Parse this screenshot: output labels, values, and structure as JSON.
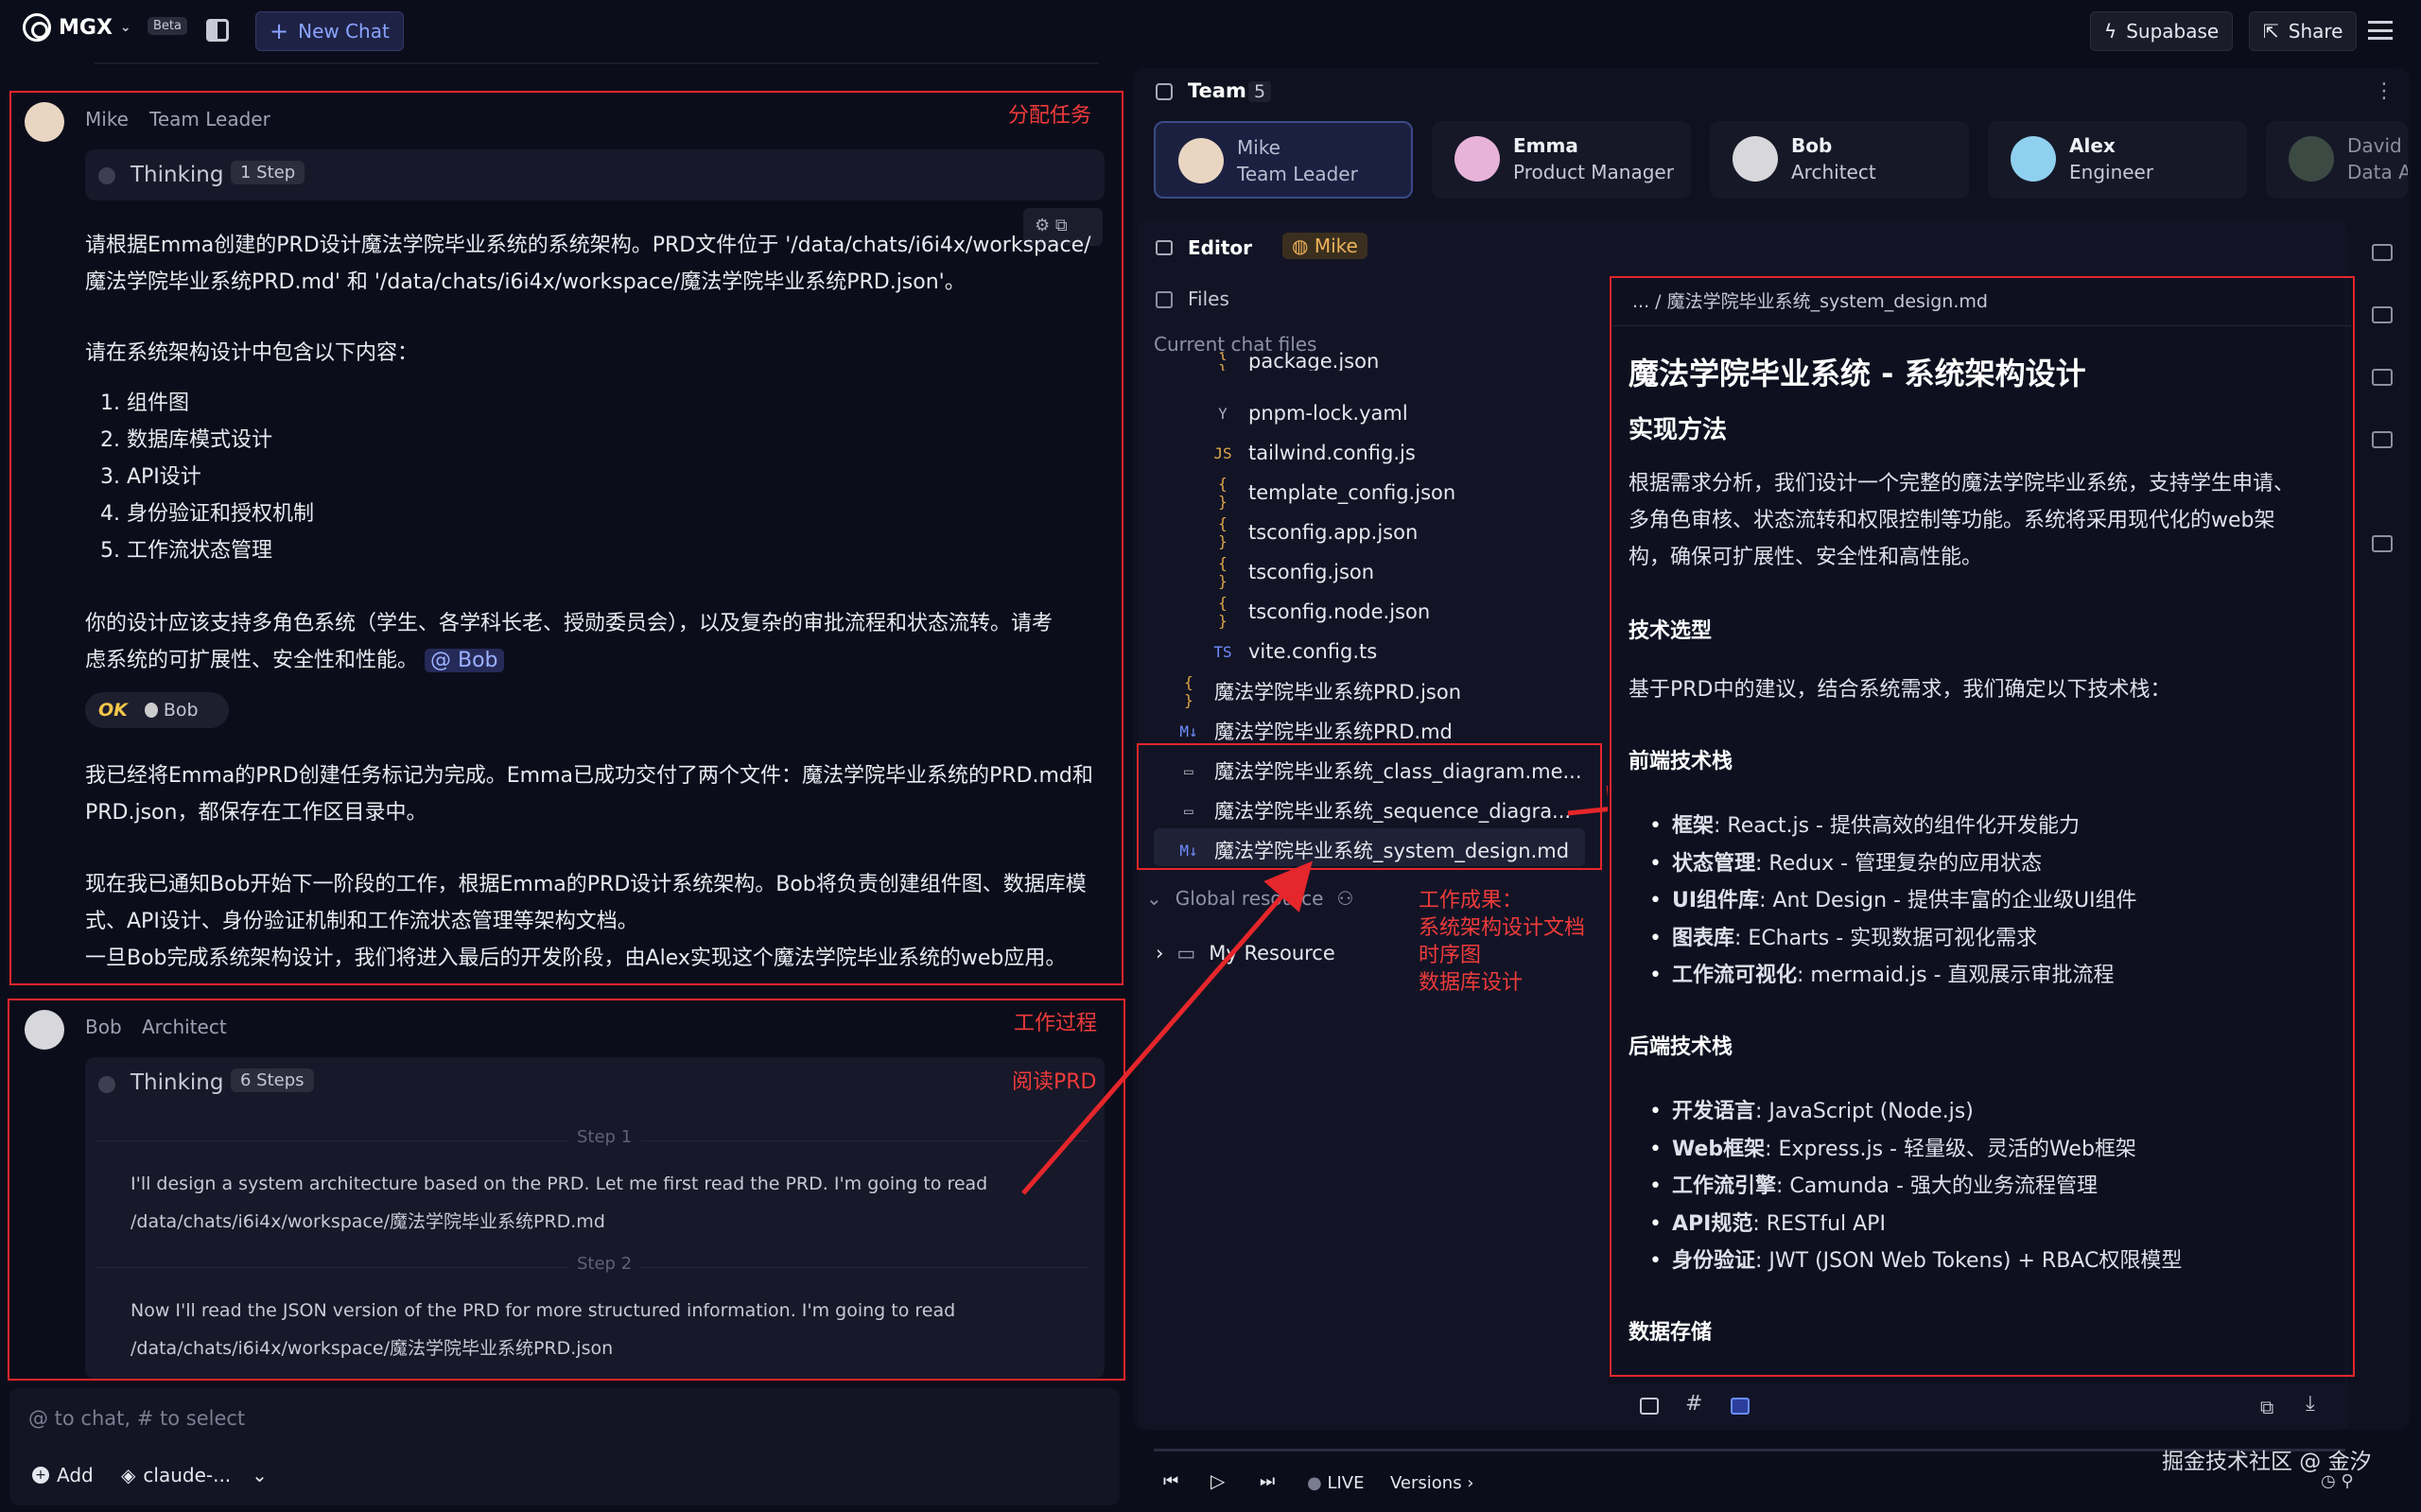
{
  "header": {
    "brand": "MGX",
    "beta": "Beta",
    "new_chat": "New Chat",
    "supabase": "Supabase",
    "share": "Share"
  },
  "chat": {
    "mike": {
      "name": "Mike",
      "role": "Team Leader",
      "annotation": "分配任务",
      "thinking": "Thinking",
      "steps": "1 Step",
      "p1": "请根据Emma创建的PRD设计魔法学院毕业系统的系统架构。PRD文件位于 '/data/chats/i6i4x/workspace/",
      "p1b": "魔法学院毕业系统PRD.md' 和 '/data/chats/i6i4x/workspace/魔法学院毕业系统PRD.json'。",
      "p2": "请在系统架构设计中包含以下内容：",
      "list": [
        "1. 组件图",
        "2. 数据库模式设计",
        "3. API设计",
        "4. 身份验证和授权机制",
        "5. 工作流状态管理"
      ],
      "p3": "你的设计应该支持多角色系统（学生、各学科长老、授勋委员会），以及复杂的审批流程和状态流转。请考",
      "p3b": "虑系统的可扩展性、安全性和性能。",
      "mention": "@ Bob",
      "ok": "OK",
      "ok_user": "Bob",
      "p4": "我已经将Emma的PRD创建任务标记为完成。Emma已成功交付了两个文件：魔法学院毕业系统的PRD.md和",
      "p4b": "PRD.json，都保存在工作区目录中。",
      "p5": "现在我已通知Bob开始下一阶段的工作，根据Emma的PRD设计系统架构。Bob将负责创建组件图、数据库模",
      "p5b": "式、API设计、身份验证机制和工作流状态管理等架构文档。",
      "p5c": "一旦Bob完成系统架构设计，我们将进入最后的开发阶段，由Alex实现这个魔法学院毕业系统的web应用。"
    },
    "bob": {
      "name": "Bob",
      "role": "Architect",
      "annotation": "工作过程",
      "annotation2": "阅读PRD",
      "thinking": "Thinking",
      "steps": "6 Steps",
      "step1": "Step 1",
      "s1a": "I'll design a system architecture based on the PRD. Let me first read the PRD. I'm going to read",
      "s1b": "/data/chats/i6i4x/workspace/魔法学院毕业系统PRD.md",
      "step2": "Step 2",
      "s2a": "Now I'll read the JSON version of the PRD for more structured information. I'm going to read",
      "s2b": "/data/chats/i6i4x/workspace/魔法学院毕业系统PRD.json"
    },
    "input_placeholder": "@ to chat, # to select",
    "add": "Add",
    "model": "claude-..."
  },
  "team": {
    "title": "Team",
    "count": "5",
    "members": [
      {
        "name": "Mike",
        "role": "Team Leader"
      },
      {
        "name": "Emma",
        "role": "Product Manager"
      },
      {
        "name": "Bob",
        "role": "Architect"
      },
      {
        "name": "Alex",
        "role": "Engineer"
      },
      {
        "name": "David",
        "role": "Data Ai"
      }
    ]
  },
  "editor": {
    "label": "Editor",
    "owner": "Mike",
    "files": "Files",
    "current": "Current chat files",
    "file_list": [
      {
        "name": "package.json",
        "icon": "{ }"
      },
      {
        "name": "pnpm-lock.yaml",
        "icon": "Y"
      },
      {
        "name": "tailwind.config.js",
        "icon": "JS"
      },
      {
        "name": "template_config.json",
        "icon": "{ }"
      },
      {
        "name": "tsconfig.app.json",
        "icon": "{ }"
      },
      {
        "name": "tsconfig.json",
        "icon": "{ }"
      },
      {
        "name": "tsconfig.node.json",
        "icon": "{ }"
      },
      {
        "name": "vite.config.ts",
        "icon": "TS"
      },
      {
        "name": "魔法学院毕业系统PRD.json",
        "icon": "{ }"
      },
      {
        "name": "魔法学院毕业系统PRD.md",
        "icon": "M↓"
      },
      {
        "name": "魔法学院毕业系统_class_diagram.me...",
        "icon": "▭"
      },
      {
        "name": "魔法学院毕业系统_sequence_diagra...",
        "icon": "▭"
      },
      {
        "name": "魔法学院毕业系统_system_design.md",
        "icon": "M↓"
      }
    ],
    "global": "Global resource",
    "my_resource": "My Resource",
    "annotation": [
      "工作成果：",
      "系统架构设计文档",
      "时序图",
      "数据库设计"
    ],
    "breadcrumb": "... / 魔法学院毕业系统_system_design.md",
    "live": "LIVE",
    "versions": "Versions"
  },
  "doc": {
    "h1": "魔法学院毕业系统 - 系统架构设计",
    "h2": "实现方法",
    "p1a": "根据需求分析，我们设计一个完整的魔法学院毕业系统，支持学生申请、",
    "p1b": "多角色审核、状态流转和权限控制等功能。系统将采用现代化的web架",
    "p1c": "构，确保可扩展性、安全性和高性能。",
    "h3a": "技术选型",
    "p2": "基于PRD中的建议，结合系统需求，我们确定以下技术栈：",
    "h3b": "前端技术栈",
    "front": [
      [
        "框架",
        ": React.js - 提供高效的组件化开发能力"
      ],
      [
        "状态管理",
        ": Redux - 管理复杂的应用状态"
      ],
      [
        "UI组件库",
        ": Ant Design - 提供丰富的企业级UI组件"
      ],
      [
        "图表库",
        ": ECharts - 实现数据可视化需求"
      ],
      [
        "工作流可视化",
        ": mermaid.js - 直观展示审批流程"
      ]
    ],
    "h3c": "后端技术栈",
    "back": [
      [
        "开发语言",
        ": JavaScript (Node.js)"
      ],
      [
        "Web框架",
        ": Express.js - 轻量级、灵活的Web框架"
      ],
      [
        "工作流引擎",
        ": Camunda - 强大的业务流程管理"
      ],
      [
        "API规范",
        ": RESTful API"
      ],
      [
        "身份验证",
        ": JWT (JSON Web Tokens) + RBAC权限模型"
      ]
    ],
    "h3d": "数据存储"
  },
  "watermark": "掘金技术社区 @ 金汐"
}
